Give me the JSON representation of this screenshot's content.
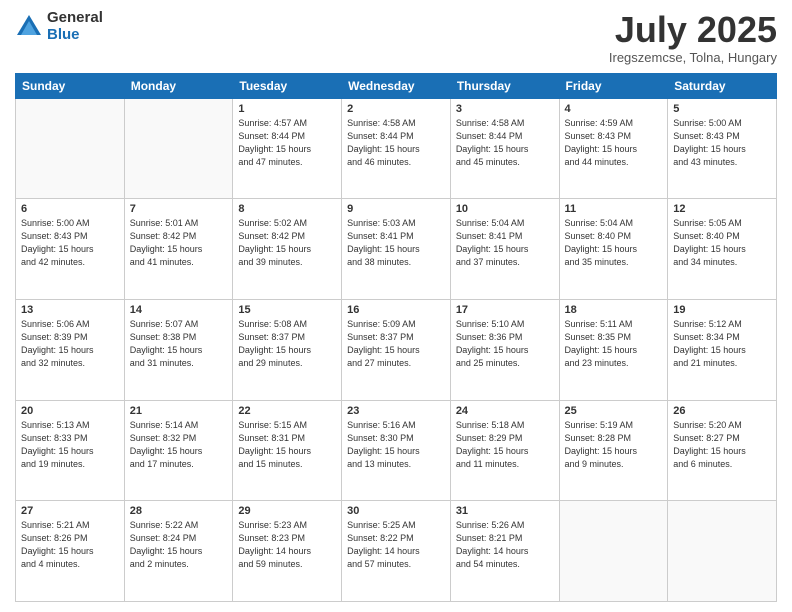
{
  "logo": {
    "general": "General",
    "blue": "Blue"
  },
  "header": {
    "month": "July 2025",
    "location": "Iregszemcse, Tolna, Hungary"
  },
  "weekdays": [
    "Sunday",
    "Monday",
    "Tuesday",
    "Wednesday",
    "Thursday",
    "Friday",
    "Saturday"
  ],
  "weeks": [
    [
      {
        "day": "",
        "info": ""
      },
      {
        "day": "",
        "info": ""
      },
      {
        "day": "1",
        "info": "Sunrise: 4:57 AM\nSunset: 8:44 PM\nDaylight: 15 hours\nand 47 minutes."
      },
      {
        "day": "2",
        "info": "Sunrise: 4:58 AM\nSunset: 8:44 PM\nDaylight: 15 hours\nand 46 minutes."
      },
      {
        "day": "3",
        "info": "Sunrise: 4:58 AM\nSunset: 8:44 PM\nDaylight: 15 hours\nand 45 minutes."
      },
      {
        "day": "4",
        "info": "Sunrise: 4:59 AM\nSunset: 8:43 PM\nDaylight: 15 hours\nand 44 minutes."
      },
      {
        "day": "5",
        "info": "Sunrise: 5:00 AM\nSunset: 8:43 PM\nDaylight: 15 hours\nand 43 minutes."
      }
    ],
    [
      {
        "day": "6",
        "info": "Sunrise: 5:00 AM\nSunset: 8:43 PM\nDaylight: 15 hours\nand 42 minutes."
      },
      {
        "day": "7",
        "info": "Sunrise: 5:01 AM\nSunset: 8:42 PM\nDaylight: 15 hours\nand 41 minutes."
      },
      {
        "day": "8",
        "info": "Sunrise: 5:02 AM\nSunset: 8:42 PM\nDaylight: 15 hours\nand 39 minutes."
      },
      {
        "day": "9",
        "info": "Sunrise: 5:03 AM\nSunset: 8:41 PM\nDaylight: 15 hours\nand 38 minutes."
      },
      {
        "day": "10",
        "info": "Sunrise: 5:04 AM\nSunset: 8:41 PM\nDaylight: 15 hours\nand 37 minutes."
      },
      {
        "day": "11",
        "info": "Sunrise: 5:04 AM\nSunset: 8:40 PM\nDaylight: 15 hours\nand 35 minutes."
      },
      {
        "day": "12",
        "info": "Sunrise: 5:05 AM\nSunset: 8:40 PM\nDaylight: 15 hours\nand 34 minutes."
      }
    ],
    [
      {
        "day": "13",
        "info": "Sunrise: 5:06 AM\nSunset: 8:39 PM\nDaylight: 15 hours\nand 32 minutes."
      },
      {
        "day": "14",
        "info": "Sunrise: 5:07 AM\nSunset: 8:38 PM\nDaylight: 15 hours\nand 31 minutes."
      },
      {
        "day": "15",
        "info": "Sunrise: 5:08 AM\nSunset: 8:37 PM\nDaylight: 15 hours\nand 29 minutes."
      },
      {
        "day": "16",
        "info": "Sunrise: 5:09 AM\nSunset: 8:37 PM\nDaylight: 15 hours\nand 27 minutes."
      },
      {
        "day": "17",
        "info": "Sunrise: 5:10 AM\nSunset: 8:36 PM\nDaylight: 15 hours\nand 25 minutes."
      },
      {
        "day": "18",
        "info": "Sunrise: 5:11 AM\nSunset: 8:35 PM\nDaylight: 15 hours\nand 23 minutes."
      },
      {
        "day": "19",
        "info": "Sunrise: 5:12 AM\nSunset: 8:34 PM\nDaylight: 15 hours\nand 21 minutes."
      }
    ],
    [
      {
        "day": "20",
        "info": "Sunrise: 5:13 AM\nSunset: 8:33 PM\nDaylight: 15 hours\nand 19 minutes."
      },
      {
        "day": "21",
        "info": "Sunrise: 5:14 AM\nSunset: 8:32 PM\nDaylight: 15 hours\nand 17 minutes."
      },
      {
        "day": "22",
        "info": "Sunrise: 5:15 AM\nSunset: 8:31 PM\nDaylight: 15 hours\nand 15 minutes."
      },
      {
        "day": "23",
        "info": "Sunrise: 5:16 AM\nSunset: 8:30 PM\nDaylight: 15 hours\nand 13 minutes."
      },
      {
        "day": "24",
        "info": "Sunrise: 5:18 AM\nSunset: 8:29 PM\nDaylight: 15 hours\nand 11 minutes."
      },
      {
        "day": "25",
        "info": "Sunrise: 5:19 AM\nSunset: 8:28 PM\nDaylight: 15 hours\nand 9 minutes."
      },
      {
        "day": "26",
        "info": "Sunrise: 5:20 AM\nSunset: 8:27 PM\nDaylight: 15 hours\nand 6 minutes."
      }
    ],
    [
      {
        "day": "27",
        "info": "Sunrise: 5:21 AM\nSunset: 8:26 PM\nDaylight: 15 hours\nand 4 minutes."
      },
      {
        "day": "28",
        "info": "Sunrise: 5:22 AM\nSunset: 8:24 PM\nDaylight: 15 hours\nand 2 minutes."
      },
      {
        "day": "29",
        "info": "Sunrise: 5:23 AM\nSunset: 8:23 PM\nDaylight: 14 hours\nand 59 minutes."
      },
      {
        "day": "30",
        "info": "Sunrise: 5:25 AM\nSunset: 8:22 PM\nDaylight: 14 hours\nand 57 minutes."
      },
      {
        "day": "31",
        "info": "Sunrise: 5:26 AM\nSunset: 8:21 PM\nDaylight: 14 hours\nand 54 minutes."
      },
      {
        "day": "",
        "info": ""
      },
      {
        "day": "",
        "info": ""
      }
    ]
  ]
}
